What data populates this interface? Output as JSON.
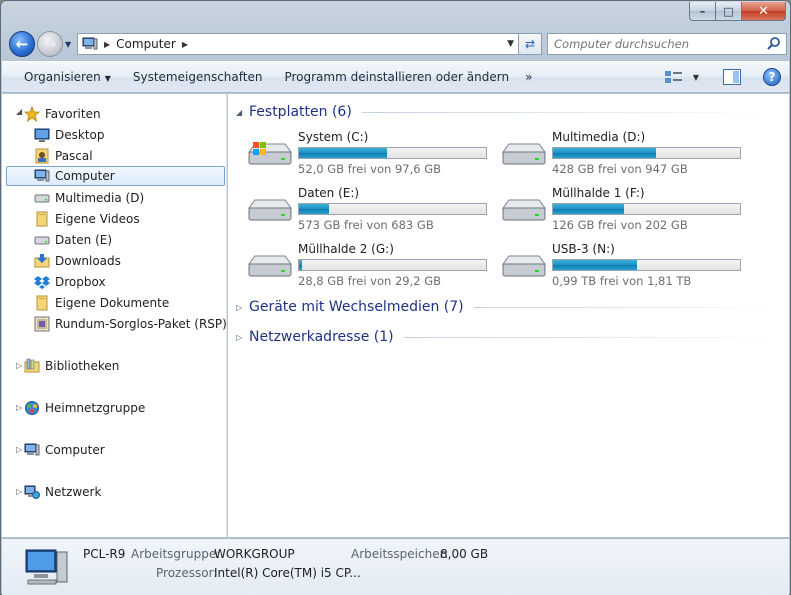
{
  "window": {
    "caption": {
      "minimize": "–",
      "maximize": "□",
      "close": "✕"
    }
  },
  "address": {
    "location": "Computer",
    "search_placeholder": "Computer durchsuchen"
  },
  "toolbar": {
    "organize": "Organisieren",
    "system_properties": "Systemeigenschaften",
    "uninstall": "Programm deinstallieren oder ändern",
    "more": "»",
    "help": "?"
  },
  "sidebar": {
    "favorites": {
      "label": "Favoriten",
      "items": [
        {
          "label": "Desktop",
          "icon": "desktop-icon"
        },
        {
          "label": "Pascal",
          "icon": "user-folder-icon"
        },
        {
          "label": "Computer",
          "icon": "computer-icon",
          "selected": true
        },
        {
          "label": "Multimedia (D)",
          "icon": "drive-icon"
        },
        {
          "label": "Eigene Videos",
          "icon": "folder-icon"
        },
        {
          "label": "Daten (E)",
          "icon": "drive-icon"
        },
        {
          "label": "Downloads",
          "icon": "downloads-icon"
        },
        {
          "label": "Dropbox",
          "icon": "dropbox-icon"
        },
        {
          "label": "Eigene Dokumente",
          "icon": "folder-icon"
        },
        {
          "label": "Rundum-Sorglos-Paket (RSP)",
          "icon": "package-icon"
        }
      ]
    },
    "libraries": "Bibliotheken",
    "homegroup": "Heimnetzgruppe",
    "computer": "Computer",
    "network": "Netzwerk"
  },
  "groups": {
    "hard_drives": {
      "title": "Festplatten (6)",
      "drives": [
        {
          "name": "System (C:)",
          "free_text": "52,0 GB frei von 97,6 GB",
          "used_fraction": 0.47,
          "system": true
        },
        {
          "name": "Multimedia (D:)",
          "free_text": "428 GB frei von 947 GB",
          "used_fraction": 0.55
        },
        {
          "name": "Daten (E:)",
          "free_text": "573 GB frei von 683 GB",
          "used_fraction": 0.16
        },
        {
          "name": "Müllhalde 1 (F:)",
          "free_text": "126 GB frei von 202 GB",
          "used_fraction": 0.38
        },
        {
          "name": "Müllhalde 2 (G:)",
          "free_text": "28,8 GB frei von 29,2 GB",
          "used_fraction": 0.014
        },
        {
          "name": "USB-3 (N:)",
          "free_text": "0,99 TB frei von 1,81 TB",
          "used_fraction": 0.45
        }
      ]
    },
    "removable": {
      "title": "Geräte mit Wechselmedien (7)"
    },
    "network": {
      "title": "Netzwerkadresse (1)"
    }
  },
  "details": {
    "name": "PCL-R9",
    "workgroup_label": "Arbeitsgruppe:",
    "workgroup_value": "WORKGROUP",
    "memory_label": "Arbeitsspeicher:",
    "memory_value": "8,00 GB",
    "processor_label": "Prozessor:",
    "processor_value": "Intel(R) Core(TM) i5 CP..."
  }
}
